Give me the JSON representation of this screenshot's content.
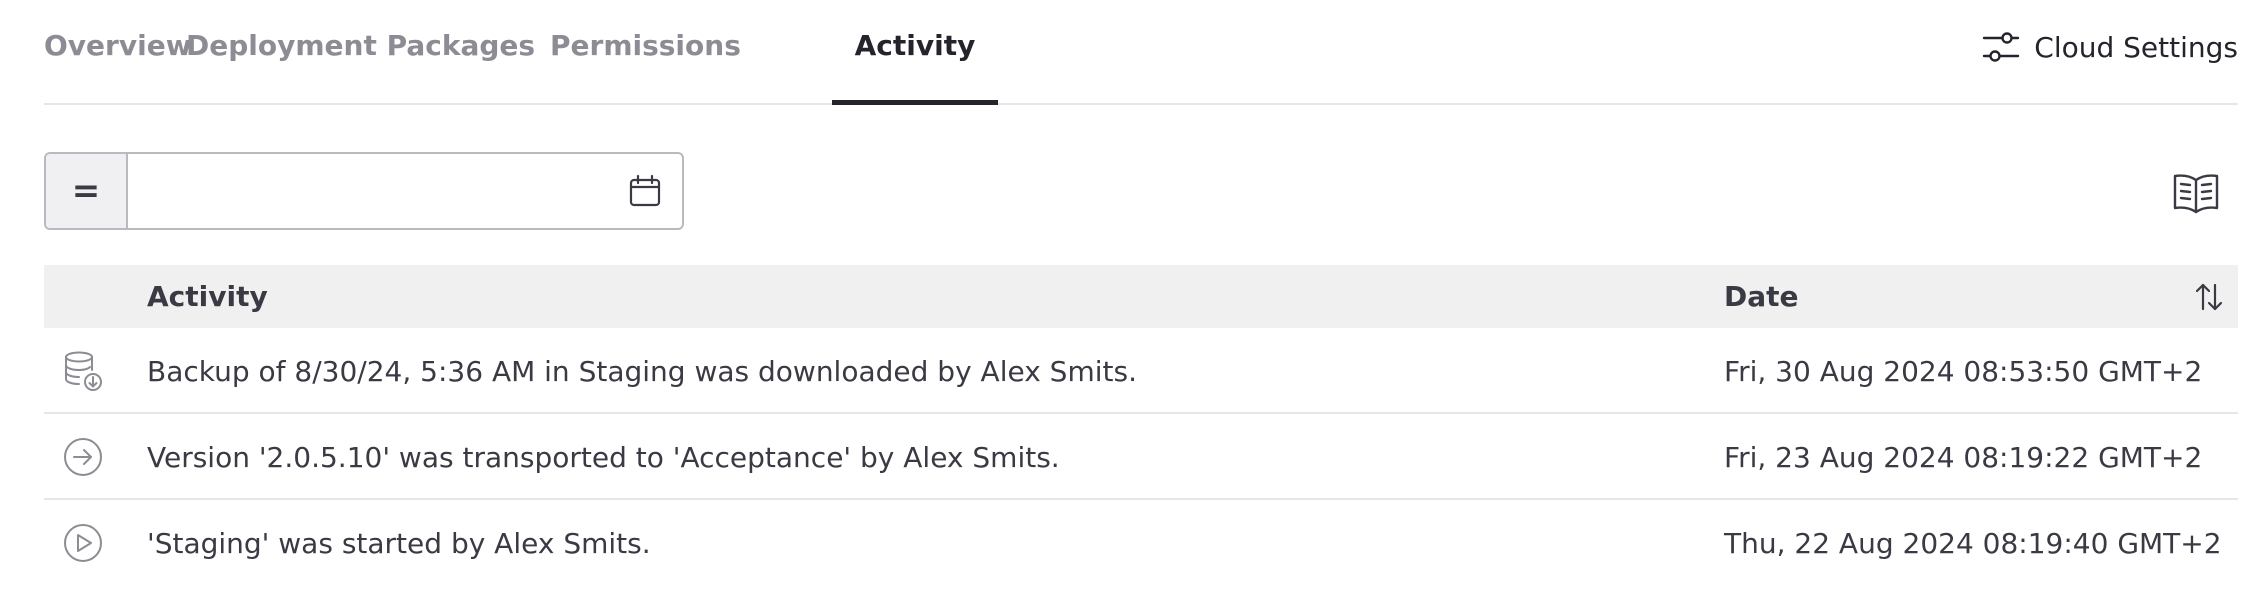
{
  "tabs": [
    {
      "label": "Overview",
      "active": false
    },
    {
      "label": "Deployment Packages",
      "active": false
    },
    {
      "label": "Permissions",
      "active": false
    },
    {
      "label": "Activity",
      "active": true
    }
  ],
  "cloud_settings": {
    "label": "Cloud Settings",
    "icon": "sliders-icon"
  },
  "filter": {
    "operator": "=",
    "date_value": "",
    "date_placeholder": "",
    "calendar_icon": "calendar-icon"
  },
  "docs_icon": "open-book-icon",
  "table": {
    "columns": {
      "activity": "Activity",
      "date": "Date"
    },
    "sort_icon": "sort-arrows-icon",
    "rows": [
      {
        "icon": "database-download-icon",
        "activity": "Backup of 8/30/24, 5:36 AM in Staging was downloaded by Alex Smits.",
        "date": "Fri, 30 Aug 2024 08:53:50 GMT+2"
      },
      {
        "icon": "arrow-right-circle-icon",
        "activity": "Version '2.0.5.10' was transported to 'Acceptance' by Alex Smits.",
        "date": "Fri, 23 Aug 2024 08:19:22 GMT+2"
      },
      {
        "icon": "play-circle-icon",
        "activity": "'Staging' was started by Alex Smits.",
        "date": "Thu, 22 Aug 2024 08:19:40 GMT+2"
      }
    ]
  },
  "colors": {
    "text_primary": "#24242c",
    "text_muted": "#8c8c94",
    "header_bg": "#f0f0f0",
    "border": "#e6e6ea"
  }
}
